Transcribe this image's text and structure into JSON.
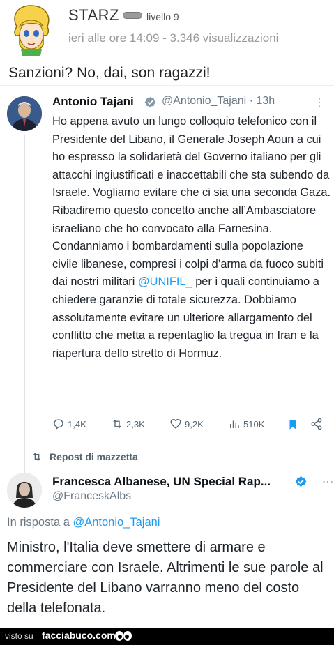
{
  "post": {
    "username": "STARZ",
    "level": "livello 9",
    "meta": "ieri alle ore 14:09 - 3.346 visualizzazioni",
    "caption": "Sanzioni? No, dai, son ragazzi!"
  },
  "tweet": {
    "name": "Antonio Tajani",
    "handle_time": "@Antonio_Tajani · 13h",
    "more": "⋮",
    "body_part1": "Ho appena avuto un lungo colloquio telefonico con il Presidente del Libano, il Generale Joseph Aoun a cui ho espresso la solidarietà del Governo italiano per gli attacchi ingiustificati e inaccettabili che sta subendo da Israele. Vogliamo evitare che ci sia una seconda Gaza. Ribadiremo questo concetto anche all’Ambasciatore israeliano che ho convocato alla Farnesina. Condanniamo i bombardamenti sulla popolazione civile libanese, compresi i colpi d’arma da fuoco subiti dai nostri militari ",
    "mention": "@UNIFIL_",
    "body_part2": " per i quali continuiamo a chiedere garanzie di totale sicurezza. Dobbiamo assolutamente evitare un ulteriore allargamento del conflitto che metta a repentaglio la tregua in Iran e la riapertura dello stretto di Hormuz.",
    "replies": "1,4K",
    "reposts": "2,3K",
    "likes": "9,2K",
    "views": "510K"
  },
  "repost_label": "Repost di mazzetta",
  "reply": {
    "name": "Francesca Albanese, UN Special Rap...",
    "handle": "@FranceskAlbs",
    "reply_to_prefix": "In risposta a ",
    "reply_to_mention": "@Antonio_Tajani",
    "body": "Ministro, l'Italia deve smettere di armare e commerciare con Israele. Altrimenti le sue parole al Presidente del Libano varranno meno del costo della telefonata."
  },
  "footer": {
    "visto": "visto su",
    "site": "facciabuco.com"
  },
  "colors": {
    "accent": "#1d9bf0",
    "bookmark": "#1d9bf0",
    "footer_bg": "#000000"
  }
}
